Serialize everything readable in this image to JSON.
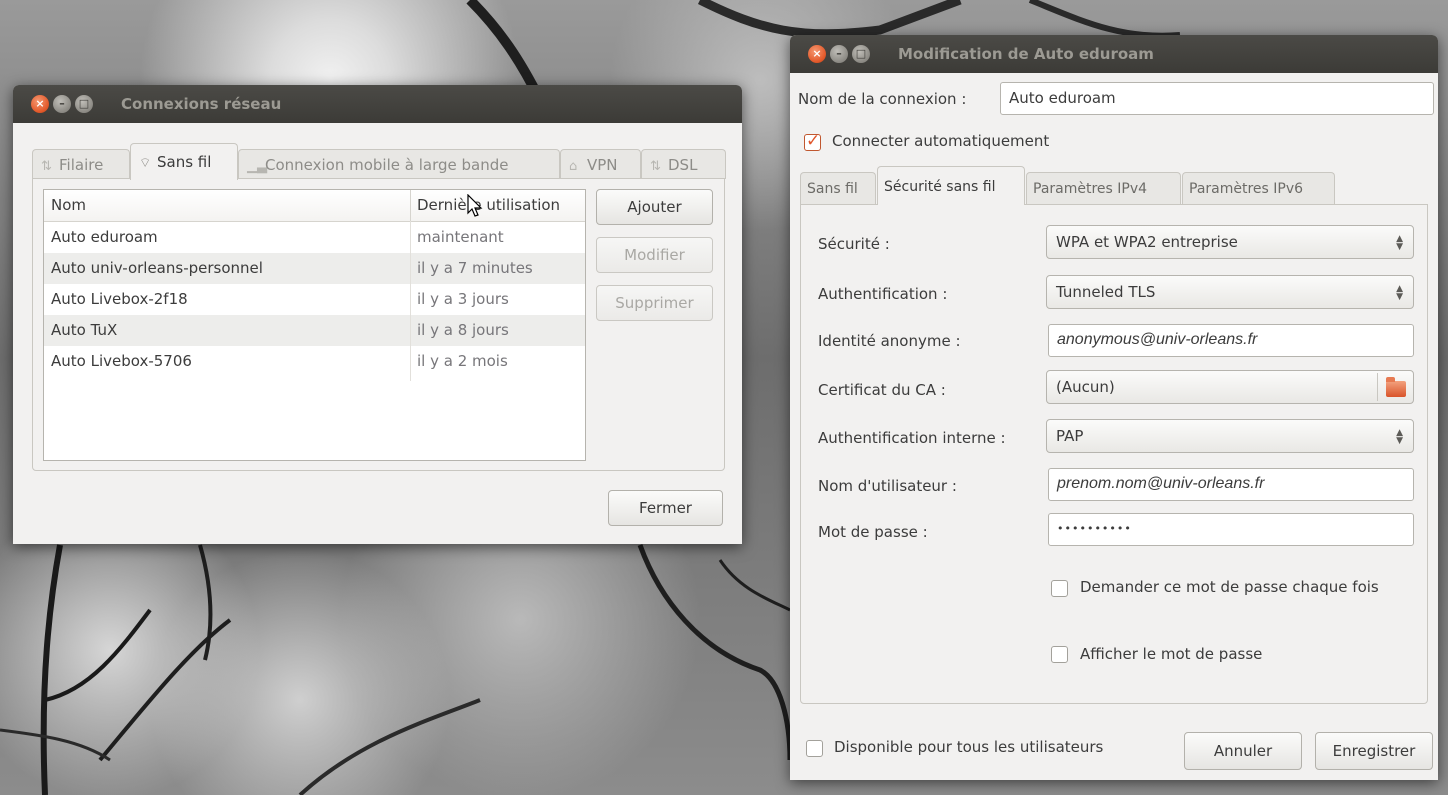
{
  "net_window": {
    "title": "Connexions réseau",
    "tabs": [
      {
        "label": "Filaire",
        "icon": "ethernet-icon"
      },
      {
        "label": "Sans fil",
        "icon": "wifi-icon"
      },
      {
        "label": "Connexion mobile à large bande",
        "icon": "signal-bars-icon"
      },
      {
        "label": "VPN",
        "icon": "lock-icon"
      },
      {
        "label": "DSL",
        "icon": "dsl-icon"
      }
    ],
    "columns": {
      "name": "Nom",
      "last_used": "Dernière utilisation"
    },
    "connections": [
      {
        "name": "Auto eduroam",
        "last_used": "maintenant"
      },
      {
        "name": "Auto univ-orleans-personnel",
        "last_used": "il y a 7 minutes"
      },
      {
        "name": "Auto Livebox-2f18",
        "last_used": "il y a 3 jours"
      },
      {
        "name": "Auto TuX",
        "last_used": "il y a 8 jours"
      },
      {
        "name": "Auto Livebox-5706",
        "last_used": "il y a 2 mois"
      }
    ],
    "buttons": {
      "add": "Ajouter",
      "edit": "Modifier",
      "delete": "Supprimer",
      "close": "Fermer"
    }
  },
  "edit_window": {
    "title": "Modification de Auto eduroam",
    "connection_name_label": "Nom de la connexion :",
    "connection_name_value": "Auto eduroam",
    "auto_connect_label": "Connecter automatiquement",
    "auto_connect_checked": true,
    "tabs": [
      "Sans fil",
      "Sécurité sans fil",
      "Paramètres IPv4",
      "Paramètres IPv6"
    ],
    "active_tab": "Sécurité sans fil",
    "fields": {
      "security_label": "Sécurité :",
      "security_value": "WPA et WPA2 entreprise",
      "auth_label": "Authentification :",
      "auth_value": "Tunneled TLS",
      "anon_label": "Identité anonyme :",
      "anon_value": "anonymous@univ-orleans.fr",
      "ca_label": "Certificat du CA :",
      "ca_value": "(Aucun)",
      "inner_auth_label": "Authentification interne :",
      "inner_auth_value": "PAP",
      "username_label": "Nom d'utilisateur :",
      "username_value": "prenom.nom@univ-orleans.fr",
      "password_label": "Mot de passe :",
      "password_value": "••••••••••"
    },
    "ask_password_label": "Demander ce mot de passe chaque fois",
    "show_password_label": "Afficher le mot de passe",
    "all_users_label": "Disponible pour tous les utilisateurs",
    "buttons": {
      "cancel": "Annuler",
      "save": "Enregistrer"
    }
  }
}
